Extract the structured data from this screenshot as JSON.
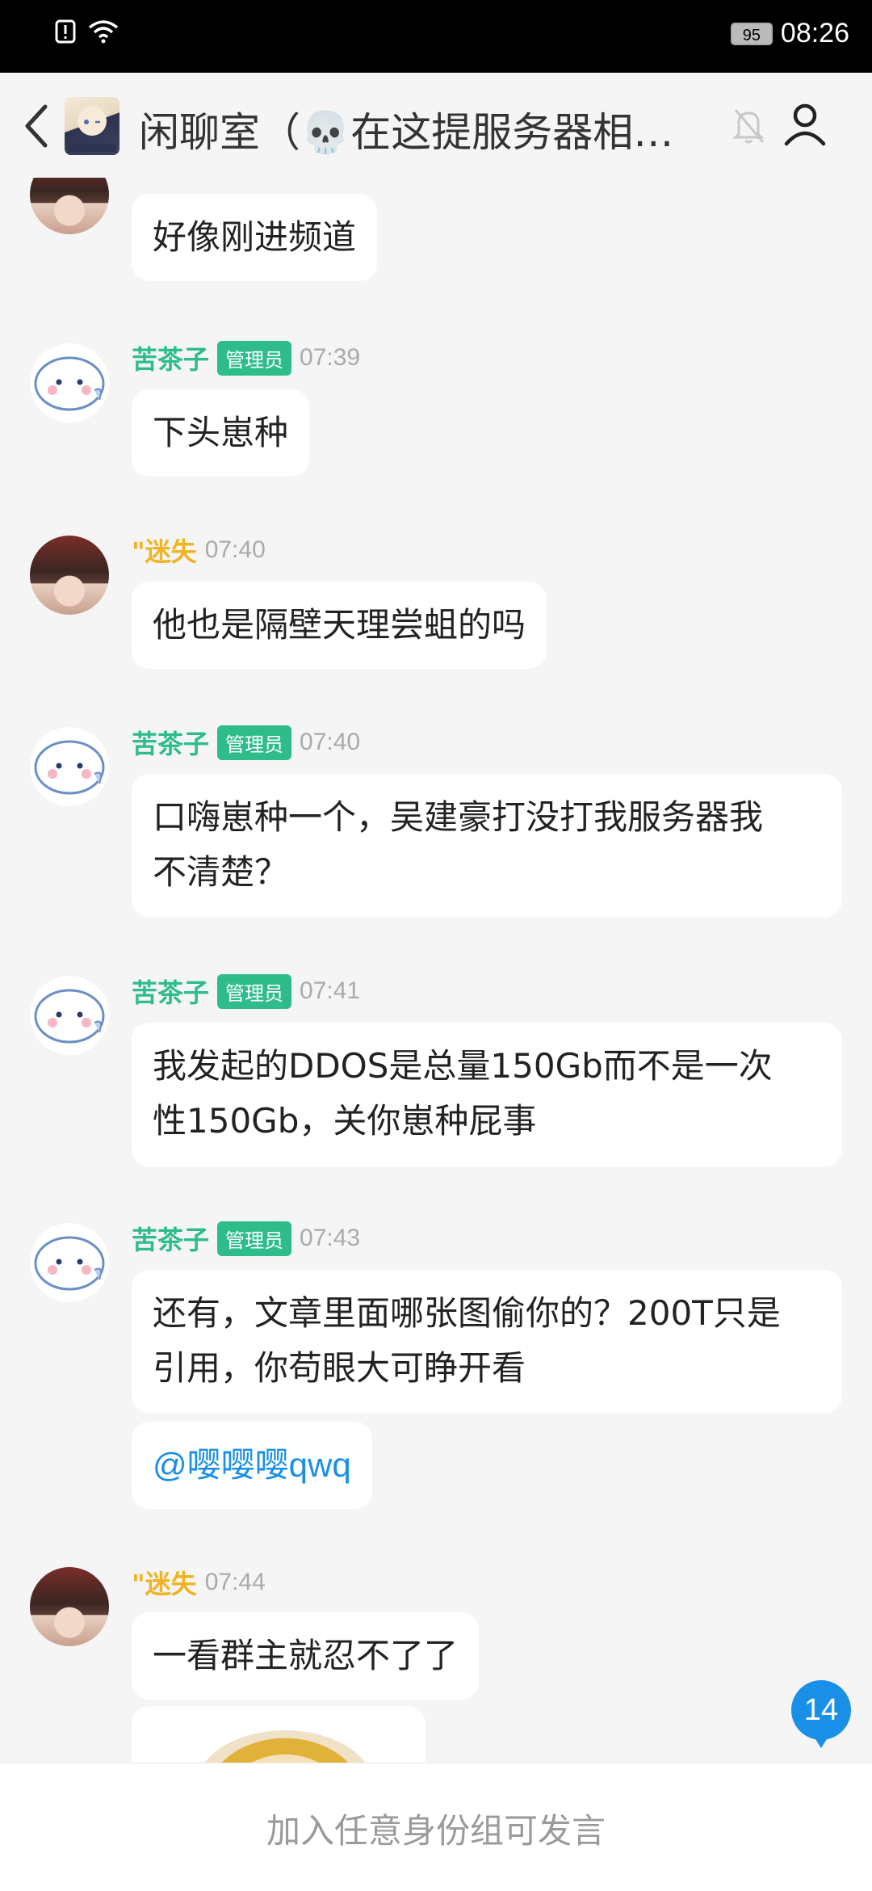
{
  "status_bar": {
    "battery": "95",
    "time": "08:26"
  },
  "header": {
    "title": "闲聊室（💀在这提服务器相关问题）"
  },
  "messages": [
    {
      "text": "好像刚进频道"
    },
    {
      "user": "苦茶子",
      "role": "管理员",
      "time": "07:39",
      "text": "下头崽种"
    },
    {
      "user": "\"迷失",
      "time": "07:40",
      "text": "他也是隔壁天理尝蛆的吗"
    },
    {
      "user": "苦茶子",
      "role": "管理员",
      "time": "07:40",
      "line1": "口嗨崽种一个，吴建豪打没打我服务器我",
      "line2": "不清楚？"
    },
    {
      "user": "苦茶子",
      "role": "管理员",
      "time": "07:41",
      "line1": "我发起的DDOS是总量150Gb而不是一次",
      "line2": "性150Gb，关你崽种屁事"
    },
    {
      "user": "苦茶子",
      "role": "管理员",
      "time": "07:43",
      "line1": "还有，文章里面哪张图偷你的？200T只是",
      "line2": "引用，你苟眼大可睁开看",
      "mention": "@嘤嘤嘤qwq"
    },
    {
      "user": "\"迷失",
      "time": "07:44",
      "text": "一看群主就忍不了了"
    }
  ],
  "unread_count": "14",
  "bottom_bar": {
    "text": "加入任意身份组可发言"
  },
  "colors": {
    "admin_name": "#2ebd8a",
    "member_name": "#f0b323",
    "mention": "#1a8fe8",
    "badge": "#1a8fe8"
  },
  "icons": [
    "alert-icon",
    "wifi-icon",
    "back-arrow-icon",
    "room-avatar",
    "bell-off-icon",
    "person-icon"
  ]
}
